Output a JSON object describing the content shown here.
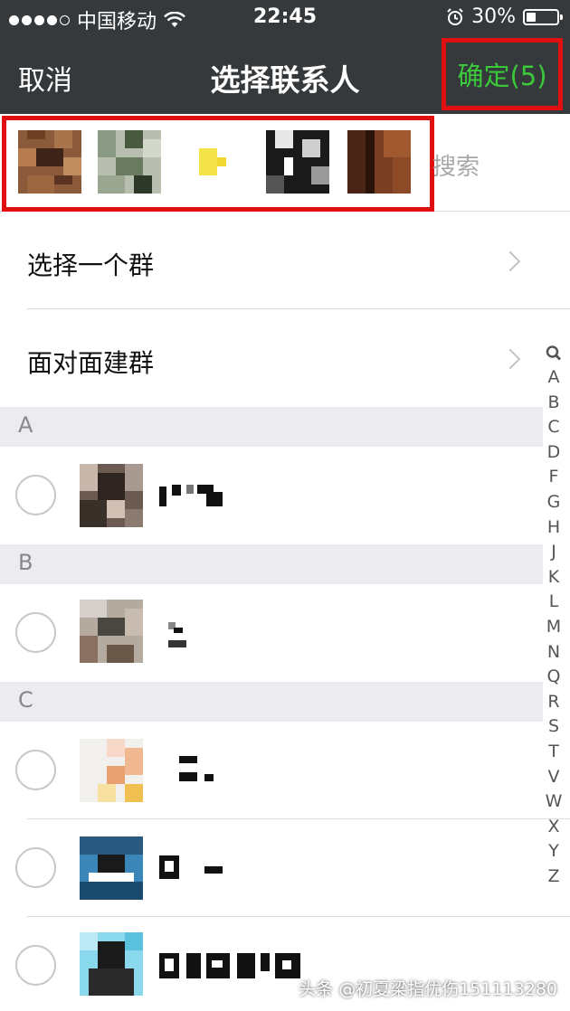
{
  "status_bar": {
    "carrier": "中国移动",
    "time": "22:45",
    "battery_percent": "30%",
    "battery_level": 0.3
  },
  "nav": {
    "cancel_label": "取消",
    "title": "选择联系人",
    "confirm_label": "确定(5)"
  },
  "selected": {
    "search_placeholder": "搜索",
    "avatars": [
      "selected-contact-1",
      "selected-contact-2",
      "selected-contact-3",
      "selected-contact-4",
      "selected-contact-5"
    ]
  },
  "options": {
    "select_group": "选择一个群",
    "face_to_face": "面对面建群"
  },
  "sections": {
    "a": "A",
    "b": "B",
    "c": "C"
  },
  "index": [
    "A",
    "B",
    "C",
    "D",
    "F",
    "G",
    "H",
    "J",
    "K",
    "L",
    "M",
    "N",
    "Q",
    "R",
    "S",
    "T",
    "V",
    "W",
    "X",
    "Y",
    "Z"
  ],
  "colors": {
    "nav_background": "#36393b",
    "confirm_green": "#3bc93b",
    "highlight_red": "#e01010",
    "section_background": "#ebebf0"
  },
  "watermark": "头条 @初夏梁指优伤151113280"
}
